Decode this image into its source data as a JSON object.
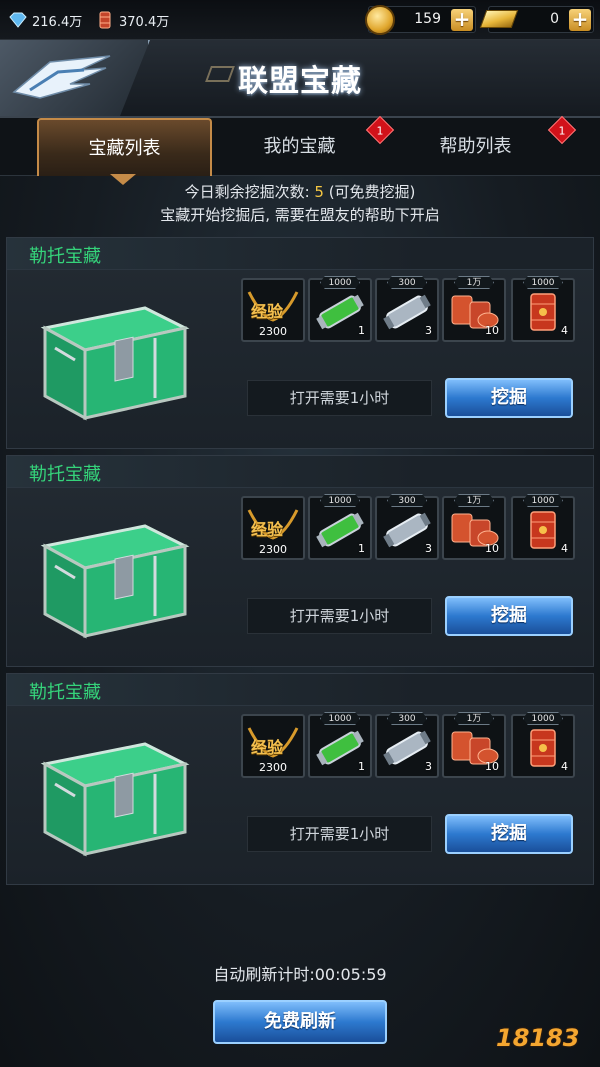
{
  "status": {
    "resource1": "216.4万",
    "resource2": "370.4万",
    "coins": "159",
    "gold": "0"
  },
  "header": {
    "title": "联盟宝藏"
  },
  "tabs": [
    {
      "label": "宝藏列表",
      "active": true
    },
    {
      "label": "我的宝藏",
      "badge": "1"
    },
    {
      "label": "帮助列表",
      "badge": "1"
    }
  ],
  "info": {
    "remaining_prefix": "今日剩余挖掘次数: ",
    "remaining_count": "5",
    "remaining_suffix": " (可免费挖掘)",
    "line2": "宝藏开始挖掘后, 需要在盟友的帮助下开启"
  },
  "cards": [
    {
      "title": "勒托宝藏",
      "timer": "打开需要1小时",
      "dig_label": "挖掘"
    },
    {
      "title": "勒托宝藏",
      "timer": "打开需要1小时",
      "dig_label": "挖掘"
    },
    {
      "title": "勒托宝藏",
      "timer": "打开需要1小时",
      "dig_label": "挖掘"
    }
  ],
  "rewards": [
    {
      "kind": "exp",
      "label": "经验",
      "amount": "2300",
      "tag": "",
      "icon": "exp-badge-icon"
    },
    {
      "kind": "item",
      "tag": "1000",
      "count": "1",
      "icon": "green-canister-icon"
    },
    {
      "kind": "item",
      "tag": "300",
      "count": "3",
      "icon": "silver-canister-icon"
    },
    {
      "kind": "item",
      "tag": "1万",
      "count": "10",
      "icon": "oil-drums-icon"
    },
    {
      "kind": "item",
      "tag": "1000",
      "count": "4",
      "icon": "oil-barrel-icon"
    }
  ],
  "footer": {
    "auto_refresh": "自动刷新计时:00:05:59",
    "refresh_button": "免费刷新",
    "watermark": "18183"
  }
}
